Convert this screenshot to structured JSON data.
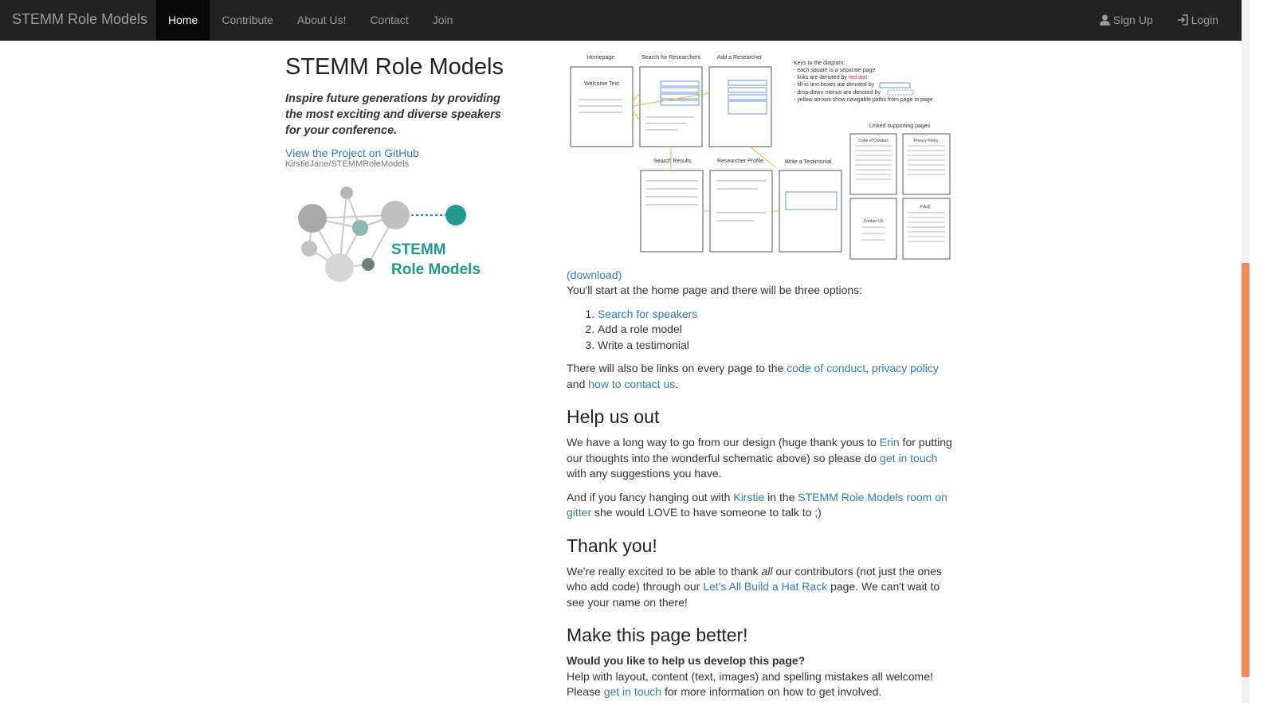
{
  "navbar": {
    "brand": "STEMM Role Models",
    "items": [
      "Home",
      "Contribute",
      "About Us!",
      "Contact",
      "Join"
    ],
    "signup": "Sign Up",
    "login": "Login"
  },
  "sidebar": {
    "title": "STEMM Role Models",
    "tagline": "Inspire future generations by providing the most exciting and diverse speakers for your conference.",
    "github_link": "View the Project on GitHub",
    "github_sub": "KirstieJane/STEMMRoleModels",
    "logo_line1": "STEMM",
    "logo_line2": "Role Models"
  },
  "diagram": {
    "homepage": "Homepage",
    "search": "Search for Researchers",
    "add": "Add a Researcher",
    "results": "Search Results",
    "profile": "Researcher Profile",
    "testimonial": "Write a Testimonial",
    "linked": "Linked supporting pages",
    "welcome": "Welcome Text",
    "keys_title": "Keys to the diagram:",
    "key1": "- each square is a separate page",
    "key2": "- links are denoted by",
    "key2_red": "red text",
    "key3": "- fill-in text boxes are denoted by",
    "key4": "- drop-down menus are denoted by",
    "key5": "- yellow arrows show navigable paths from page to page",
    "coc": "Code of Conduct",
    "privacy": "Privacy Policy",
    "contact": "Contact Us",
    "faq": "F.A.Q."
  },
  "main": {
    "download": "(download)",
    "intro": "You'll start at the home page and there will be three options:",
    "options": [
      "Search for speakers",
      "Add a role model",
      "Write a testimonial"
    ],
    "links_p1": "There will also be links on every page to the ",
    "link_coc": "code of conduct",
    "links_p2": ", ",
    "link_privacy": "privacy policy",
    "links_p3": " and ",
    "link_contact": "how to contact us",
    "links_p4": ".",
    "help_heading": "Help us out",
    "help_p1a": "We have a long way to go from our design (huge thank yous to ",
    "help_erin": "Erin",
    "help_p1b": " for putting our thoughts into the wonderful schematic above) so please do ",
    "help_touch": "get in touch",
    "help_p1c": " with any suggestions you have.",
    "help_p2a": "And if you fancy hanging out with ",
    "help_kirstie": "Kirstie",
    "help_p2b": " in the ",
    "help_gitter": "STEMM Role Models room on gitter",
    "help_p2c": " she would LOVE to have someone to talk to ;)",
    "thanks_heading": "Thank you!",
    "thanks_a": "We're really excited to be able to thank ",
    "thanks_all": "all",
    "thanks_b": " our contributors (not just the ones who add code) through our ",
    "thanks_link": "Let's All Build a Hat Rack",
    "thanks_c": " page. We can't wait to see your name on there!",
    "better_heading": "Make this page better!",
    "better_bold": "Would you like to help us develop this page?",
    "better_p1": "Help with layout, content (text, images) and spelling mistakes all welcome!",
    "better_p2a": "Please ",
    "better_touch": "get in touch",
    "better_p2b": " for more information on how to get involved."
  }
}
